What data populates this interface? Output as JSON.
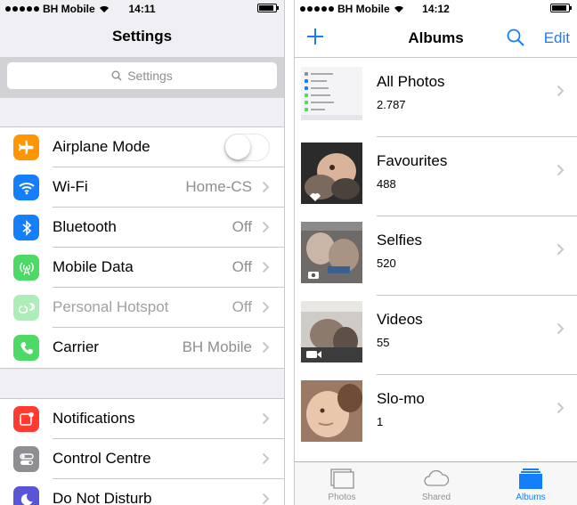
{
  "settings": {
    "status": {
      "carrier": "BH Mobile",
      "time": "14:11"
    },
    "title": "Settings",
    "search_placeholder": "Settings",
    "groups": [
      {
        "rows": [
          {
            "label": "Airplane Mode",
            "value": "",
            "toggle": false,
            "icon": "airplane-icon",
            "icon_color": "#ff9500"
          },
          {
            "label": "Wi-Fi",
            "value": "Home-CS",
            "icon": "wifi-icon",
            "icon_color": "#157efb"
          },
          {
            "label": "Bluetooth",
            "value": "Off",
            "icon": "bluetooth-icon",
            "icon_color": "#157efb"
          },
          {
            "label": "Mobile Data",
            "value": "Off",
            "icon": "antenna-icon",
            "icon_color": "#4cd964"
          },
          {
            "label": "Personal Hotspot",
            "value": "Off",
            "icon": "hotspot-icon",
            "icon_color": "#4cd964",
            "disabled": true
          },
          {
            "label": "Carrier",
            "value": "BH Mobile",
            "icon": "phone-icon",
            "icon_color": "#4cd964"
          }
        ]
      },
      {
        "rows": [
          {
            "label": "Notifications",
            "icon": "notifications-icon",
            "icon_color": "#ff3b30"
          },
          {
            "label": "Control Centre",
            "icon": "control-centre-icon",
            "icon_color": "#8e8e93"
          },
          {
            "label": "Do Not Disturb",
            "icon": "moon-icon",
            "icon_color": "#5856d6"
          }
        ]
      }
    ]
  },
  "albums": {
    "status": {
      "carrier": "BH Mobile",
      "time": "14:12"
    },
    "title": "Albums",
    "edit_label": "Edit",
    "items": [
      {
        "name": "All Photos",
        "count": "2.787"
      },
      {
        "name": "Favourites",
        "count": "488"
      },
      {
        "name": "Selfies",
        "count": "520"
      },
      {
        "name": "Videos",
        "count": "55"
      },
      {
        "name": "Slo-mo",
        "count": "1"
      }
    ],
    "tabs": [
      {
        "label": "Photos",
        "icon": "photos-stack-icon",
        "active": false
      },
      {
        "label": "Shared",
        "icon": "cloud-icon",
        "active": false
      },
      {
        "label": "Albums",
        "icon": "albums-icon",
        "active": true
      }
    ],
    "accent": "#157efb"
  }
}
